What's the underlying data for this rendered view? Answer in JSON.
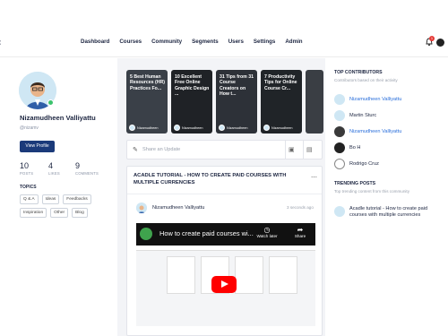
{
  "nav": {
    "items": [
      "Dashboard",
      "Courses",
      "Community",
      "Segments",
      "Users",
      "Settings",
      "Admin"
    ],
    "notification_count": "1"
  },
  "profile": {
    "name": "Nizamudheen Valliyattu",
    "handle": "@nizamv",
    "view_button": "View Profile",
    "stats": [
      {
        "value": "10",
        "label": "POSTS"
      },
      {
        "value": "4",
        "label": "LIKES"
      },
      {
        "value": "9",
        "label": "COMMENTS"
      }
    ],
    "topics_heading": "TOPICS",
    "topics": [
      "Q & A",
      "Ideas",
      "Feedbacks",
      "Inspiration",
      "Other",
      "Blog"
    ]
  },
  "feed": {
    "cards": [
      {
        "title": "5 Best Human Resources (HR) Practices Fo...",
        "author": "Nizamudheen",
        "color": "#3a4048"
      },
      {
        "title": "10 Excellent Free Online Graphic Design ...",
        "author": "Nizamudheen",
        "color": "#1f2226"
      },
      {
        "title": "31 Tips from 31 Course Creators on How t...",
        "author": "Nizamudheen",
        "color": "#2d3138"
      },
      {
        "title": "7 Productivity Tips for Online Course Cr...",
        "author": "Nizamudheen",
        "color": "#202428"
      },
      {
        "title": "",
        "author": "",
        "color": "#3a3e44"
      }
    ],
    "share_placeholder": "Share an Update",
    "post": {
      "title": "ACADLE TUTORIAL - HOW TO CREATE PAID COURSES WITH MULTIPLE CURRENCIES",
      "author": "Nizamudheen Valliyattu",
      "time": "3 seconds ago",
      "video_title": "How to create paid courses wi...",
      "watch_later": "Watch later",
      "share": "Share"
    }
  },
  "right": {
    "contributors_heading": "TOP CONTRIBUTORS",
    "contributors_sub": "Contributors based on their activity",
    "contributors": [
      {
        "name": "Nizamudheen Valliyattu",
        "highlight": true
      },
      {
        "name": "Martin Sturc",
        "highlight": false
      },
      {
        "name": "Nizamudheen Valliyattu",
        "highlight": true
      },
      {
        "name": "Bo H",
        "highlight": false
      },
      {
        "name": "Rodrigo Cruz",
        "highlight": false
      }
    ],
    "trending_heading": "TRENDING POSTS",
    "trending_sub": "Top trending content from this community",
    "trending_post": "Acadle tutorial - How to create paid courses with multiple currencies"
  },
  "colors": {
    "primary": "#1b3a7a",
    "link": "#2a6fdb",
    "online": "#3cc36d",
    "youtube": "#ff0000"
  }
}
